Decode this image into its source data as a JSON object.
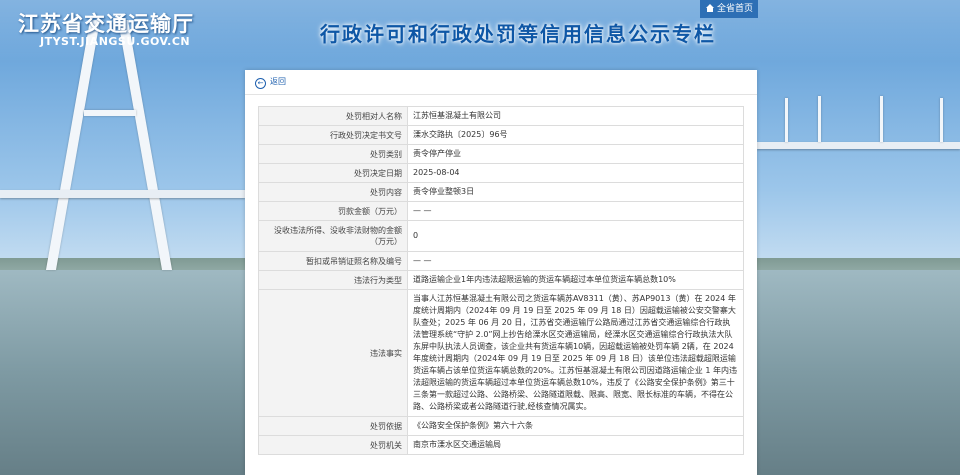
{
  "site": {
    "name": "江苏省交通运输厅",
    "url": "JTYST.JIANGSU.GOV.CN",
    "banner": "行政许可和行政处罚等信用信息公示专栏",
    "home_link": "全省首页"
  },
  "back_label": "返回",
  "rows": [
    {
      "label": "处罚相对人名称",
      "value": "江苏恒基混凝土有限公司"
    },
    {
      "label": "行政处罚决定书文号",
      "value": "溧水交路执〔2025〕96号"
    },
    {
      "label": "处罚类别",
      "value": "责令停产停业"
    },
    {
      "label": "处罚决定日期",
      "value": "2025-08-04"
    },
    {
      "label": "处罚内容",
      "value": "责令停业整顿3日"
    },
    {
      "label": "罚款金额（万元）",
      "value": "— —"
    },
    {
      "label": "没收违法所得、没收非法财物的金额（万元）",
      "value": "0"
    },
    {
      "label": "暂扣或吊销证照名称及编号",
      "value": "— —"
    },
    {
      "label": "违法行为类型",
      "value": "道路运输企业1年内违法超限运输的货运车辆超过本单位货运车辆总数10%"
    },
    {
      "label": "违法事实",
      "value": "当事人江苏恒基混凝土有限公司之货运车辆苏AV8311（黄）、苏AP9013（黄）在 2024 年度统计周期内（2024年 09 月 19 日至 2025 年 09 月 18 日）因超载运输被公安交警寨大队查处；2025 年 06 月 20 日，江苏省交通运输厅公路局通过江苏省交通运输综合行政执法管理系统“守护 2.0”网上抄告给溧水区交通运输局，经溧水区交通运输综合行政执法大队东屏中队执法人员调查，该企业共有货运车辆10辆，因超载运输被处罚车辆 2辆，在 2024 年度统计周期内（2024年 09 月 19 日至 2025 年 09 月 18 日）该单位违法超载超限运输货运车辆占该单位货运车辆总数的20%。江苏恒基混凝土有限公司因道路运输企业 1 年内违法超限运输的货运车辆超过本单位货运车辆总数10%，违反了《公路安全保护条例》第三十三条第一款超过公路、公路桥梁、公路隧道限载、限高、限宽、限长标准的车辆，不得在公路、公路桥梁或者公路隧道行驶,经核查情况属实。"
    },
    {
      "label": "处罚依据",
      "value": "《公路安全保护条例》第六十六条"
    },
    {
      "label": "处罚机关",
      "value": "南京市溧水区交通运输局"
    }
  ]
}
